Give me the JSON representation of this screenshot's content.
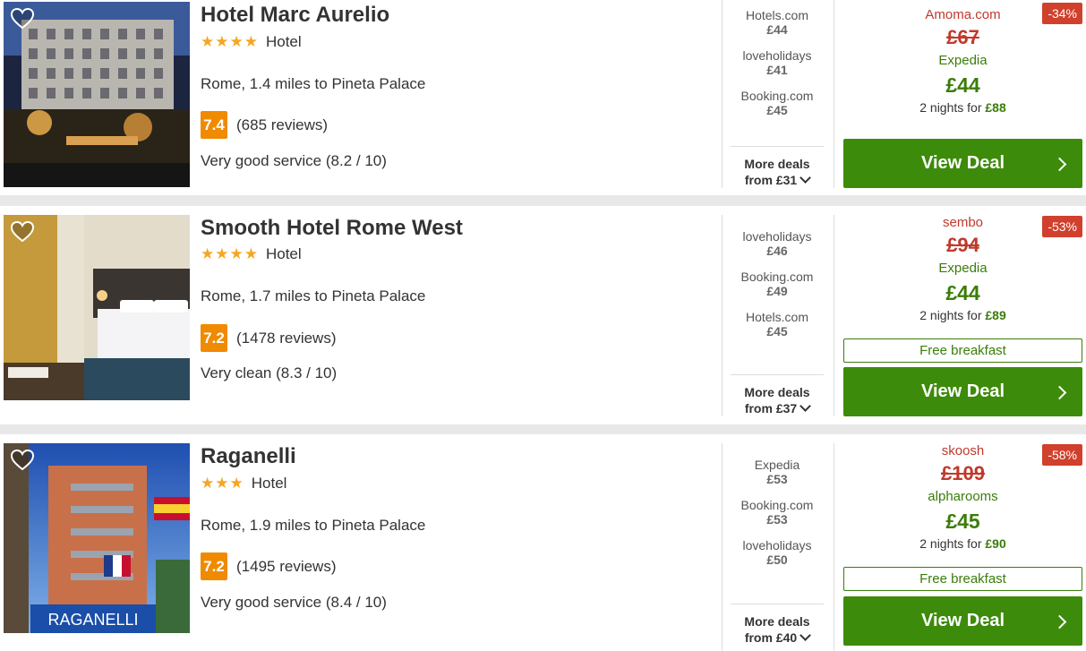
{
  "hotels": [
    {
      "name": "Hotel Marc Aurelio",
      "stars": "★★★★",
      "type": "Hotel",
      "location": "Rome, 1.4 miles to Pineta Palace",
      "score": "7.4",
      "reviews": "(685 reviews)",
      "highlight": "Very good service (8.2 / 10)",
      "deals": [
        {
          "provider": "Hotels.com",
          "price": "£44"
        },
        {
          "provider": "loveholidays",
          "price": "£41"
        },
        {
          "provider": "Booking.com",
          "price": "£45"
        }
      ],
      "more_deals_line1": "More deals",
      "more_deals_line2": "from £31",
      "old_provider": "Amoma.com",
      "old_price": "£67",
      "discount": "-34%",
      "best_provider": "Expedia",
      "best_price": "£44",
      "nights_text": "2 nights for ",
      "nights_total": "£88",
      "free_breakfast": "",
      "cta": "View Deal"
    },
    {
      "name": "Smooth Hotel Rome West",
      "stars": "★★★★",
      "type": "Hotel",
      "location": "Rome, 1.7 miles to Pineta Palace",
      "score": "7.2",
      "reviews": "(1478 reviews)",
      "highlight": "Very clean (8.3 / 10)",
      "deals": [
        {
          "provider": "loveholidays",
          "price": "£46"
        },
        {
          "provider": "Booking.com",
          "price": "£49"
        },
        {
          "provider": "Hotels.com",
          "price": "£45"
        }
      ],
      "more_deals_line1": "More deals",
      "more_deals_line2": "from £37",
      "old_provider": "sembo",
      "old_price": "£94",
      "discount": "-53%",
      "best_provider": "Expedia",
      "best_price": "£44",
      "nights_text": "2 nights for ",
      "nights_total": "£89",
      "free_breakfast": "Free breakfast",
      "cta": "View Deal"
    },
    {
      "name": "Raganelli",
      "stars": "★★★",
      "type": "Hotel",
      "location": "Rome, 1.9 miles to Pineta Palace",
      "score": "7.2",
      "reviews": "(1495 reviews)",
      "highlight": "Very good service (8.4 / 10)",
      "deals": [
        {
          "provider": "Expedia",
          "price": "£53"
        },
        {
          "provider": "Booking.com",
          "price": "£53"
        },
        {
          "provider": "loveholidays",
          "price": "£50"
        }
      ],
      "more_deals_line1": "More deals",
      "more_deals_line2": "from £40",
      "old_provider": "skoosh",
      "old_price": "£109",
      "discount": "-58%",
      "best_provider": "alpharooms",
      "best_price": "£45",
      "nights_text": "2 nights for ",
      "nights_total": "£90",
      "free_breakfast": "Free breakfast",
      "cta": "View Deal",
      "sign_text": "RAGANELLI"
    }
  ],
  "colors": {
    "score_bg": "#f08a00",
    "deal_green": "#3d8b0a",
    "discount_red": "#d0402c",
    "star_gold": "#f4a722"
  }
}
